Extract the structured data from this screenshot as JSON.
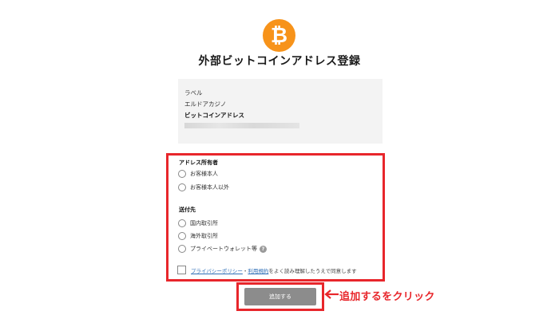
{
  "logo": {
    "symbol": "₿",
    "icon": "bitcoin-icon",
    "color": "#f7931a"
  },
  "page": {
    "title": "外部ビットコインアドレス登録"
  },
  "info": {
    "label_heading": "ラベル",
    "label_value": "エルドアカジノ",
    "address_heading": "ビットコインアドレス"
  },
  "owner": {
    "heading": "アドレス所有者",
    "options": [
      "お客様本人",
      "お客様本人以外"
    ]
  },
  "destination": {
    "heading": "送付先",
    "options": [
      "国内取引所",
      "海外取引所",
      "プライベートウォレット等"
    ]
  },
  "agreement": {
    "link_privacy": "プライバシーポリシー",
    "separator": "・",
    "link_terms": "利用規約",
    "suffix": "をよく読み理解したうえで同意します"
  },
  "actions": {
    "add_label": "追加する"
  },
  "annotation": {
    "text": "追加するをクリック",
    "color": "#e8262b"
  }
}
